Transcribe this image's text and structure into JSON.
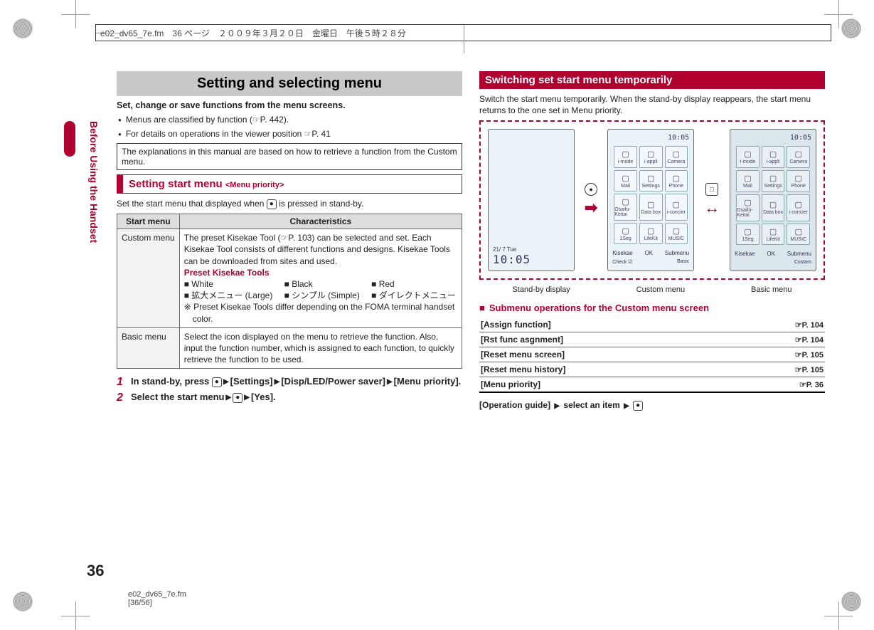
{
  "page": {
    "header_line": "e02_dv65_7e.fm　36 ページ　２００９年３月２０日　金曜日　午後５時２８分",
    "footer_file": "e02_dv65_7e.fm",
    "footer_pages": "[36/56]",
    "number": "36",
    "side_tab": "Before Using the Handset"
  },
  "left": {
    "h1": "Setting and selecting menu",
    "lead": "Set, change or save functions from the menu screens.",
    "bullets": [
      "Menus are classified by function (☞P. 442).",
      "For details on operations in the viewer position ☞P. 41"
    ],
    "note": "The explanations in this manual are based on how to retrieve a function from the Custom menu.",
    "h2": {
      "title": "Setting start menu",
      "tag": "<Menu priority>"
    },
    "intro": "Set the start menu that displayed when ",
    "intro_after": " is pressed in stand-by.",
    "intro_btn": "●",
    "table": {
      "h1": "Start menu",
      "h2": "Characteristics",
      "rows": [
        {
          "name": "Custom menu",
          "body": "The preset Kisekae Tool (☞P. 103) can be selected and set. Each Kisekae Tool consists of different functions and designs. Kisekae Tools can be downloaded from sites and used.",
          "preset_title": "Preset Kisekae Tools",
          "presets": [
            "White",
            "Black",
            "Red",
            "拡大メニュー (Large)",
            "シンプル (Simple)",
            "ダイレクトメニュー"
          ],
          "note": "Preset Kisekae Tools differ depending on the FOMA terminal handset color."
        },
        {
          "name": "Basic menu",
          "body": "Select the icon displayed on the menu to retrieve the function. Also, input the function number, which is assigned to each function, to quickly retrieve the function to be used."
        }
      ]
    },
    "steps": [
      {
        "num": "1",
        "parts": [
          "In stand-by, press ",
          {
            "btn": "●"
          },
          {
            "arrow": "▶"
          },
          "[Settings]",
          {
            "arrow": "▶"
          },
          "[Disp/LED/Power saver]",
          {
            "arrow": "▶"
          },
          "[Menu priority]."
        ]
      },
      {
        "num": "2",
        "parts": [
          "Select the start menu",
          {
            "arrow": "▶"
          },
          {
            "btn": "●"
          },
          {
            "arrow": "▶"
          },
          "[Yes]."
        ]
      }
    ]
  },
  "right": {
    "h2": "Switching set start menu temporarily",
    "intro": "Switch the start menu temporarily. When the stand-by display reappears, the start menu returns to the one set in Menu priority.",
    "standby": {
      "date": "21/ 7 Tue",
      "clock": "10:05"
    },
    "mid_btn": "●",
    "grid_labels": [
      "i-mode",
      "i-appli",
      "Camera",
      "Mail",
      "Settings",
      "Phone",
      "Osaifu-Keitai",
      "Data box",
      "i-concier",
      "1Seg",
      "LifeKit",
      "MUSIC"
    ],
    "foot_left": "Kisekae",
    "foot_mid": "OK",
    "foot_right": "Submenu",
    "basic_foot_right": "Submenu",
    "basic_row_extra": "Check ☑",
    "basic_row_extra2": "Basic",
    "basic_row_extra3": "Custom",
    "right_btn": "□",
    "captions": [
      "Stand-by display",
      "Custom menu",
      "Basic menu"
    ],
    "sub_h": "Submenu operations for the Custom menu screen",
    "refs": [
      {
        "label": "[Assign function]",
        "page": "☞P. 104"
      },
      {
        "label": "[Rst func asgnment]",
        "page": "☞P. 104"
      },
      {
        "label": "[Reset menu screen]",
        "page": "☞P. 105"
      },
      {
        "label": "[Reset menu history]",
        "page": "☞P. 105"
      },
      {
        "label": "[Menu priority]",
        "page": "☞P. 36"
      }
    ],
    "opguide": {
      "label": "[Operation guide]",
      "mid": "select an item",
      "btn": "●"
    }
  }
}
